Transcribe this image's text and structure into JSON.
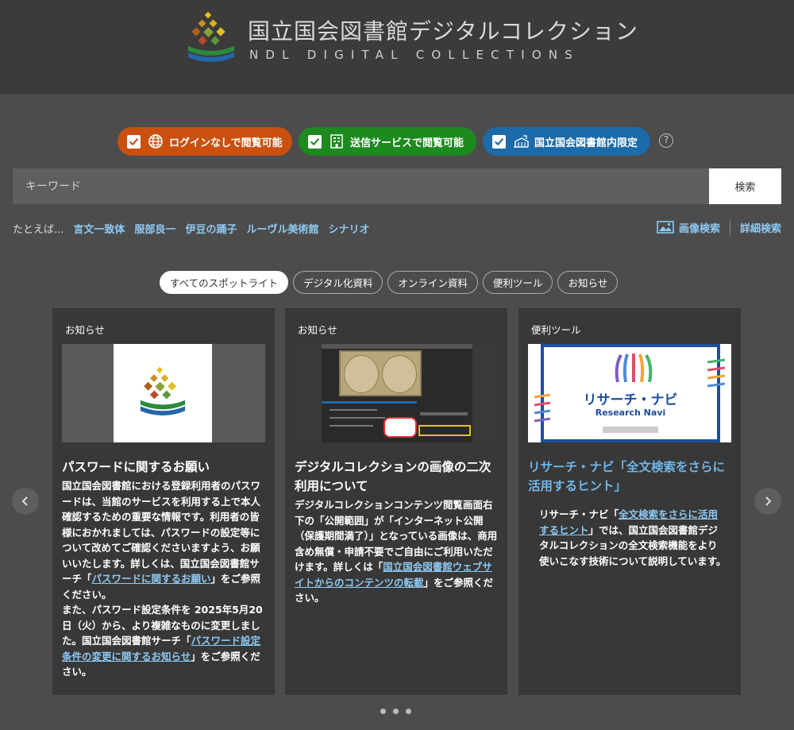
{
  "header": {
    "title_jp": "国立国会図書館デジタルコレクション",
    "title_en": "NDL DIGITAL COLLECTIONS"
  },
  "filters": [
    {
      "label": "ログインなしで閲覧可能",
      "color": "#c9500e",
      "icon": "globe-icon",
      "checked": true
    },
    {
      "label": "送信サービスで閲覧可能",
      "color": "#1c8a1e",
      "icon": "building-icon",
      "checked": true
    },
    {
      "label": "国立国会図書館内限定",
      "color": "#1d6aa8",
      "icon": "library-icon",
      "checked": true
    }
  ],
  "help": "?",
  "search": {
    "placeholder": "キーワード",
    "button": "検索"
  },
  "examples": {
    "label": "たとえば...",
    "items": [
      "言文一致体",
      "服部良一",
      "伊豆の踊子",
      "ルーヴル美術館",
      "シナリオ"
    ]
  },
  "right_links": {
    "image_search": "画像検索",
    "advanced_search": "詳細検索"
  },
  "tabs": [
    "すべてのスポットライト",
    "デジタル化資料",
    "オンライン資料",
    "便利ツール",
    "お知らせ"
  ],
  "cards": [
    {
      "category": "お知らせ",
      "title": "パスワードに関するお願い",
      "body_1": "国立国会図書館における登録利用者のパスワードは、当館のサービスを利用する上で本人確認するための重要な情報です。利用者の皆様におかれましては、パスワードの設定等について改めてご確認くださいますよう、お願いいたします。詳しくは、国立国会図書館サーチ「",
      "link_1": "パスワードに関するお願い",
      "body_2": "」をご参照ください。",
      "body_3": "また、パスワード設定条件を 2025年5月20日（火）から、より複雑なものに変更しました。国立国会図書館サーチ「",
      "link_2": "パスワード設定条件の変更に関するお知らせ",
      "body_4": "」をご参照ください。"
    },
    {
      "category": "お知らせ",
      "title": "デジタルコレクションの画像の二次利用について",
      "body_1": "デジタルコレクションコンテンツ閲覧画面右下の「公開範囲」が「インターネット公開（保護期間満了）」となっている画像は、商用含め無償・申請不要でご自由にご利用いただけます。詳しくは「",
      "link_1": "国立国会図書館ウェブサイトからのコンテンツの転載",
      "body_2": "」をご参照ください。"
    },
    {
      "category": "便利ツール",
      "title": "リサーチ・ナビ「全文検索をさらに活用するヒント」",
      "thumb_title": "リサーチ・ナビ",
      "thumb_sub": "Research Navi",
      "body_1": "リサーチ・ナビ「",
      "link_1": "全文検索をさらに活用するヒント",
      "body_2": "」では、国立国会図書館デジタルコレクションの全文検索機能をより使いこなす技術について説明しています。"
    }
  ],
  "carousel": {
    "pages": 3,
    "current": 0
  }
}
